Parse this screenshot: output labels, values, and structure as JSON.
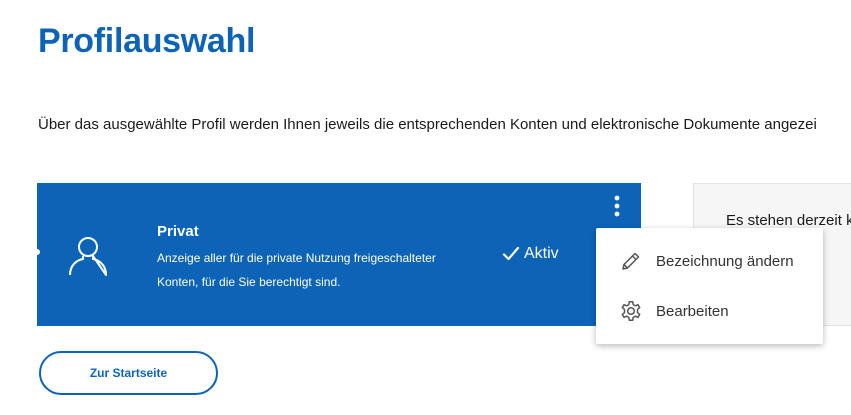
{
  "page": {
    "title": "Profilauswahl",
    "intro": "Über das ausgewählte Profil werden Ihnen jeweils die entsprechenden Konten und elektronische Dokumente angezei"
  },
  "profile_card": {
    "title": "Privat",
    "description": "Anzeige aller für die private Nutzung freigeschalteter Konten, für die Sie berechtigt sind.",
    "status": "Aktiv",
    "icons": [
      "user-icon",
      "check-icon",
      "more-vertical-icon"
    ]
  },
  "side_card": {
    "text": "Es stehen derzeit k"
  },
  "context_menu": {
    "items": [
      {
        "label": "Bezeichnung ändern",
        "icon": "pencil-icon"
      },
      {
        "label": "Bearbeiten",
        "icon": "gear-icon"
      }
    ]
  },
  "buttons": {
    "start": "Zur Startseite"
  },
  "colors": {
    "brand_blue": "#0d64b7",
    "text": "#1a1a1a",
    "menu_text": "#333333",
    "side_card_bg": "#f6f6f6"
  }
}
